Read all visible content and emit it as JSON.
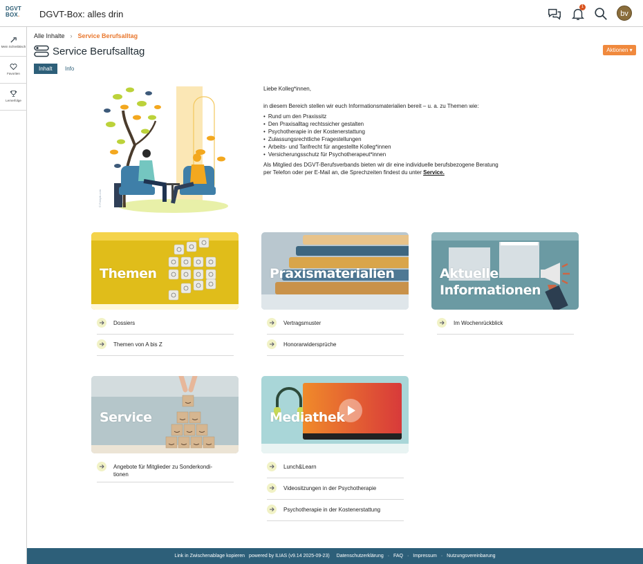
{
  "header": {
    "logo_line1": "DGVT",
    "logo_line2": "BOX",
    "app_title": "DGVT-Box: alles drin",
    "notification_count": "1",
    "avatar_initials": "bv"
  },
  "sidebar": {
    "items": [
      {
        "label": "Mein Schreibtisch",
        "icon": "desk-icon"
      },
      {
        "label": "Favoriten",
        "icon": "heart-icon"
      },
      {
        "label": "Lernerfolge",
        "icon": "trophy-icon"
      }
    ]
  },
  "breadcrumb": {
    "root": "Alle Inhalte",
    "current": "Service Berufsalltag"
  },
  "page": {
    "title": "Service Berufsalltag",
    "actions_label": "Aktionen",
    "tabs": [
      {
        "label": "Inhalt"
      },
      {
        "label": "Info"
      }
    ]
  },
  "illustration": {
    "credit": "© Freepik.com"
  },
  "intro": {
    "greeting": "Liebe Kolleg*innen,",
    "lead": "in diesem Bereich stellen wir euch Informationsmaterialien bereit – u. a. zu Themen wie:",
    "bullets": [
      "Rund um den Praxissitz",
      "Den Praxisalltag rechtssicher gestalten",
      "Psychotherapie in der Kostenerstattung",
      "Zulassungsrechtliche Fragestellungen",
      "Arbeits- und Tarifrecht für angestellte Kolleg*innen",
      "Versicherungsschutz für Psychotherapeut*innen"
    ],
    "closing": "Als Mitglied des DGVT-Berufsverbands bieten wir dir eine individuelle berufsbezogene Beratung per Telefon oder per E-Mail an, die Sprechzeiten findest du unter ",
    "closing_link": "Service."
  },
  "tiles": [
    {
      "label": "Themen",
      "links": [
        "Dossiers",
        "Themen von A bis Z"
      ]
    },
    {
      "label": "Praxismaterialien",
      "links": [
        "Vertragsmuster",
        "Honorarwidersprüche"
      ]
    },
    {
      "label_line1": "Aktuelle",
      "label_line2": "Informationen",
      "links": [
        "Im Wochenrückblick"
      ]
    },
    {
      "label": "Service",
      "links": [
        "Angebote für Mitglieder zu Sonderkondi-",
        "tionen"
      ]
    },
    {
      "label": "Mediathek",
      "links": [
        "Lunch&Learn",
        "Videositzungen in der Psychotherapie",
        "Psychotherapie in der Kostenerstattung"
      ]
    }
  ],
  "footer": {
    "items": [
      "Link in Zwischenablage kopieren",
      "powered by ILIAS (v9.14 2025-09-23)",
      "Datenschutzerklärung",
      "FAQ",
      "Impressum",
      "Nutzungsvereinbarung"
    ],
    "separator": "·"
  },
  "colors": {
    "primary": "#2d5f79",
    "accent": "#f0893d",
    "themen_tile": "#e3c21c",
    "aktuelle_tile": "#6b9aa3"
  }
}
